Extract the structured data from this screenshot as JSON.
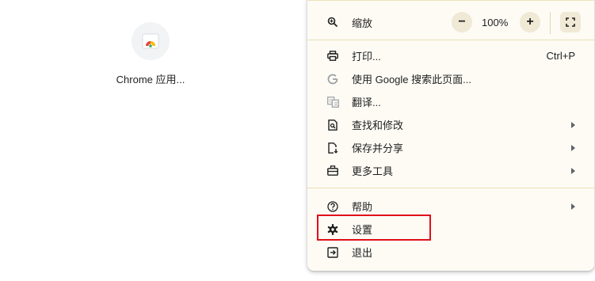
{
  "shortcut": {
    "label": "Chrome 应用..."
  },
  "menu": {
    "zoom": {
      "label": "缩放",
      "minus": "−",
      "value": "100%",
      "plus": "+"
    },
    "items": [
      {
        "label": "打印...",
        "shortcut": "Ctrl+P",
        "icon": "print-icon"
      },
      {
        "label": "使用 Google 搜索此页面...",
        "icon": "google-g-icon"
      },
      {
        "label": "翻译...",
        "icon": "translate-icon"
      },
      {
        "label": "查找和修改",
        "icon": "find-page-icon",
        "submenu": true
      },
      {
        "label": "保存并分享",
        "icon": "save-share-icon",
        "submenu": true
      },
      {
        "label": "更多工具",
        "icon": "toolbox-icon",
        "submenu": true
      },
      {
        "label": "帮助",
        "icon": "help-icon",
        "submenu": true
      },
      {
        "label": "设置",
        "icon": "gear-icon"
      },
      {
        "label": "退出",
        "icon": "exit-icon"
      }
    ]
  },
  "colors": {
    "menu_bg": "#fdfbf4",
    "separator": "#ecdfb6",
    "highlight": "#e0101a"
  }
}
